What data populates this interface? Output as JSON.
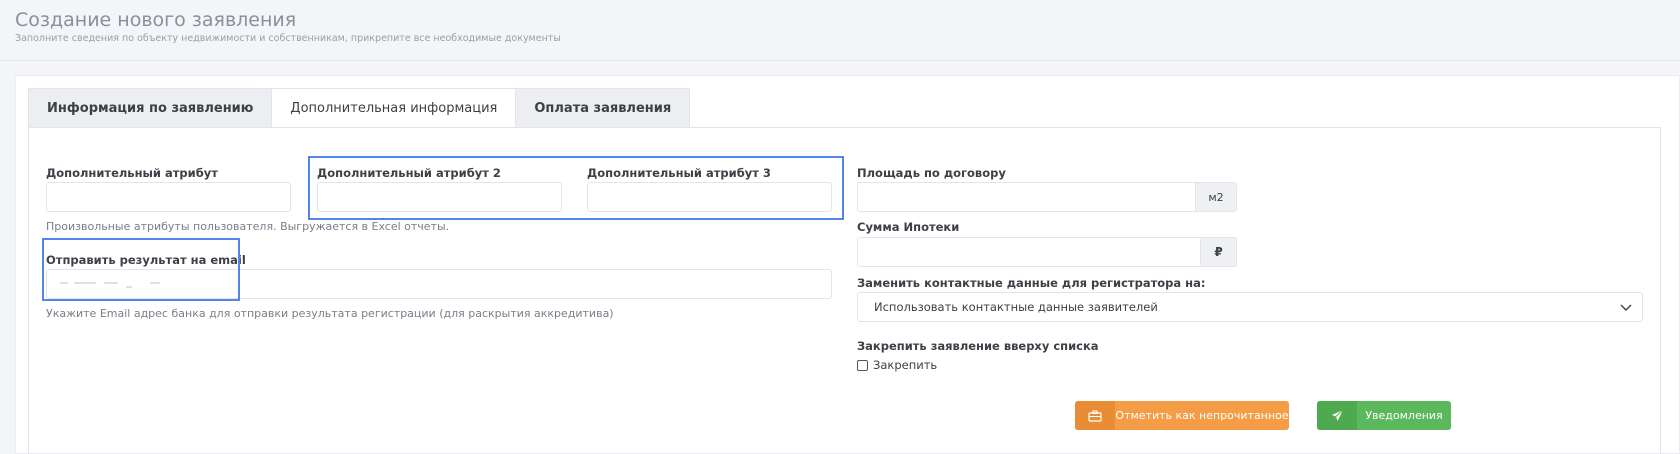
{
  "header": {
    "title": "Создание нового заявления",
    "subtitle": "Заполните сведения по объекту недвижимости и собственникам, прикрепите все необходимые документы"
  },
  "tabs": [
    {
      "label": "Информация по заявлению",
      "active": false
    },
    {
      "label": "Дополнительная информация",
      "active": true
    },
    {
      "label": "Оплата заявления",
      "active": false
    }
  ],
  "form": {
    "attr1": {
      "label": "Дополнительный атрибут",
      "value": ""
    },
    "attr2": {
      "label": "Дополнительный атрибут 2",
      "value": ""
    },
    "attr3": {
      "label": "Дополнительный атрибут 3",
      "value": ""
    },
    "attrs_help": "Произвольные атрибуты пользователя. Выгружается в Excel отчеты.",
    "email": {
      "label": "Отправить результат на email",
      "help": "Укажите Email адрес банка для отправки результата регистрации (для раскрытия аккредитива)"
    },
    "area": {
      "label": "Площадь по договору",
      "value": "",
      "unit": "м2"
    },
    "mortgage": {
      "label": "Сумма Ипотеки",
      "value": "",
      "unit": "₽"
    },
    "contact": {
      "label": "Заменить контактные данные для регистратора на:",
      "selected": "Использовать контактные данные заявителей"
    },
    "pin": {
      "label": "Закрепить заявление вверху списка",
      "checkbox_label": "Закрепить",
      "checked": false
    }
  },
  "buttons": {
    "mark_unread": "Отметить как непрочитанное",
    "notifications": "Уведомления"
  }
}
